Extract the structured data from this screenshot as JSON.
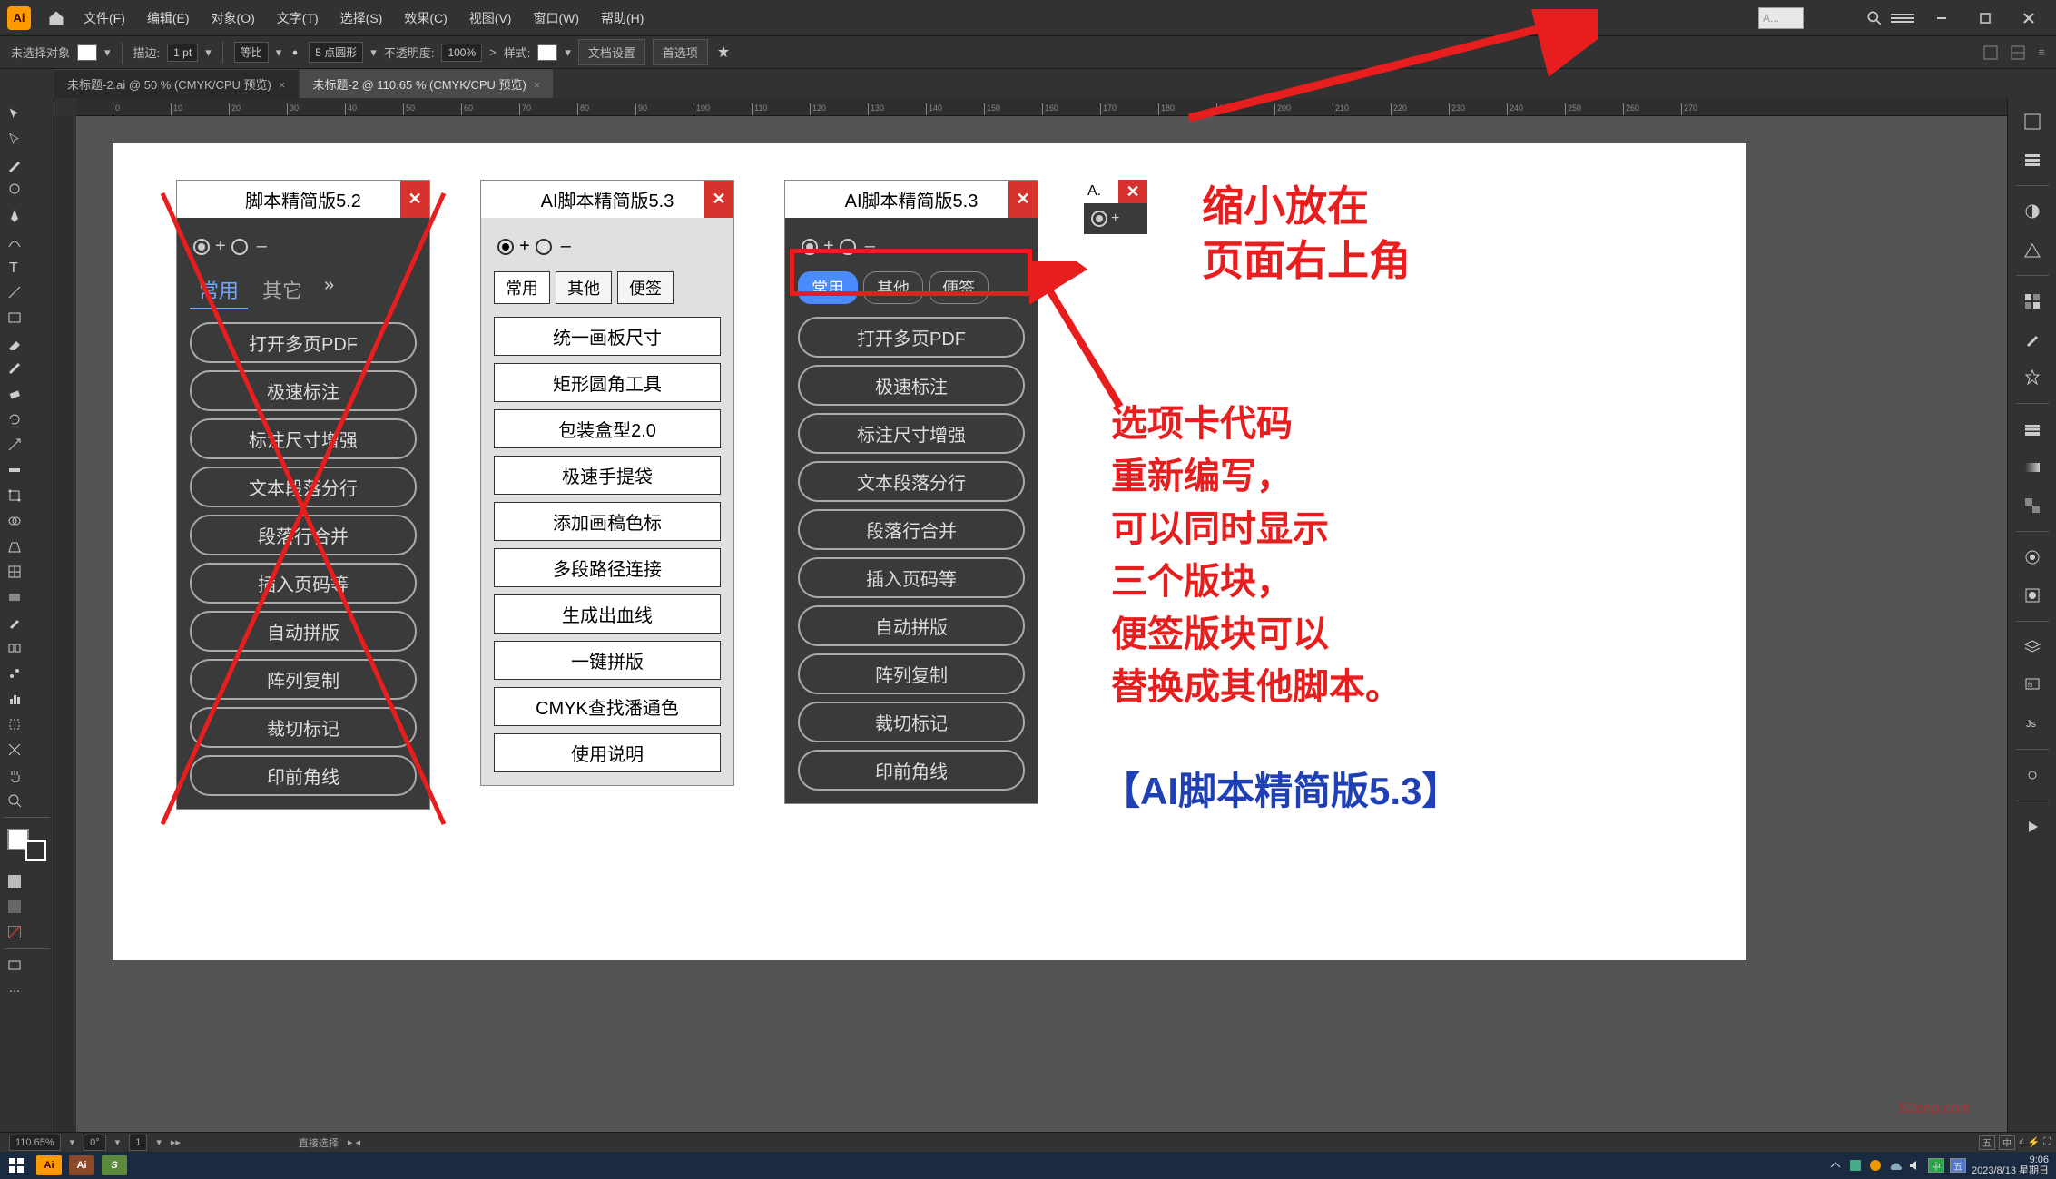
{
  "app": {
    "logo": "Ai",
    "search_hint": "A..."
  },
  "menu": [
    "文件(F)",
    "编辑(E)",
    "对象(O)",
    "文字(T)",
    "选择(S)",
    "效果(C)",
    "视图(V)",
    "窗口(W)",
    "帮助(H)"
  ],
  "ctrl": {
    "noselect": "未选择对象",
    "stroke_lbl": "描边:",
    "stroke_val": "1 pt",
    "uniform": "等比",
    "style_pts": "5 点圆形",
    "opacity_lbl": "不透明度:",
    "opacity_val": "100%",
    "style_lbl": "样式:",
    "docsetup": "文档设置",
    "prefs": "首选项"
  },
  "tabs": [
    {
      "name": "未标题-2.ai @ 50 % (CMYK/CPU 预览)",
      "active": false
    },
    {
      "name": "未标题-2 @ 110.65 % (CMYK/CPU 预览)",
      "active": true
    }
  ],
  "ruler_ticks": [
    "0",
    "10",
    "20",
    "30",
    "40",
    "50",
    "60",
    "70",
    "80",
    "90",
    "100",
    "110",
    "120",
    "130",
    "140",
    "150",
    "160",
    "170",
    "180",
    "190",
    "200",
    "210",
    "220",
    "230",
    "240",
    "250",
    "260",
    "270"
  ],
  "panel52": {
    "title": "脚本精简版5.2",
    "tabs": [
      "常用",
      "其它"
    ],
    "buttons": [
      "打开多页PDF",
      "极速标注",
      "标注尺寸增强",
      "文本段落分行",
      "段落行合并",
      "插入页码等",
      "自动拼版",
      "阵列复制",
      "裁切标记",
      "印前角线"
    ]
  },
  "panel53_light": {
    "title": "AI脚本精简版5.3",
    "tabs": [
      "常用",
      "其他",
      "便签"
    ],
    "buttons": [
      "统一画板尺寸",
      "矩形圆角工具",
      "包装盒型2.0",
      "极速手提袋",
      "添加画稿色标",
      "多段路径连接",
      "生成出血线",
      "一键拼版",
      "CMYK查找潘通色",
      "使用说明"
    ]
  },
  "panel53_dark": {
    "title": "AI脚本精简版5.3",
    "tabs": [
      "常用",
      "其他",
      "便签"
    ],
    "buttons": [
      "打开多页PDF",
      "极速标注",
      "标注尺寸增强",
      "文本段落分行",
      "段落行合并",
      "插入页码等",
      "自动拼版",
      "阵列复制",
      "裁切标记",
      "印前角线"
    ]
  },
  "mini": {
    "title": "A."
  },
  "anno": {
    "top1": "缩小放在",
    "top2": "页面右上角",
    "mid": "选项卡代码\n重新编写，\n可以同时显示\n三个版块，\n便签版块可以\n替换成其他脚本。",
    "bottom": "【AI脚本精简版5.3】"
  },
  "status": {
    "zoom": "110.65%",
    "rot": "0°",
    "xy": "1",
    "tool": "直接选择"
  },
  "tray": {
    "ime1": "五",
    "ime2": "中",
    "ime3": "中",
    "time": "9:06",
    "date": "2023/8/13 星期日"
  },
  "watermark": "52cnp.com"
}
